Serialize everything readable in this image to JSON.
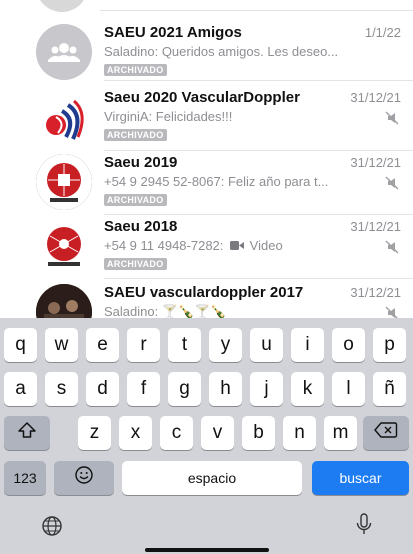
{
  "chats": [
    {
      "name": "SAEU 2021 Amigos",
      "date": "1/1/22",
      "preview": "Saladino: Queridos amigos. Les deseo...",
      "badge": "ARCHIVADO",
      "avatar_icon": "group-icon",
      "muted": false
    },
    {
      "name": "Saeu 2020 VascularDoppler",
      "date": "31/12/21",
      "preview": "VirginiA: Felicidades!!!",
      "badge": "ARCHIVADO",
      "avatar_icon": "logo-avatar",
      "muted": true
    },
    {
      "name": "Saeu 2019",
      "date": "31/12/21",
      "preview": "+54 9 2945 52-8067: Feliz año para t...",
      "badge": "ARCHIVADO",
      "avatar_icon": "poster-avatar",
      "muted": true
    },
    {
      "name": "Saeu 2018",
      "date": "31/12/21",
      "preview_sender": "+54 9 11 4948-7282:",
      "preview_media": "Video",
      "badge": "ARCHIVADO",
      "avatar_icon": "poster-avatar",
      "muted": true
    },
    {
      "name": "SAEU vasculardoppler 2017",
      "date": "31/12/21",
      "preview": "Saladino: 🍸🍾🍸🍾",
      "avatar_icon": "photo-avatar",
      "muted": true
    }
  ],
  "keyboard": {
    "row1": [
      "q",
      "w",
      "e",
      "r",
      "t",
      "y",
      "u",
      "i",
      "o",
      "p"
    ],
    "row2": [
      "a",
      "s",
      "d",
      "f",
      "g",
      "h",
      "j",
      "k",
      "l",
      "ñ"
    ],
    "row3": [
      "z",
      "x",
      "c",
      "v",
      "b",
      "n",
      "m"
    ],
    "numbers_label": "123",
    "space_label": "espacio",
    "action_label": "buscar",
    "accent_color": "#1d7cf2"
  }
}
